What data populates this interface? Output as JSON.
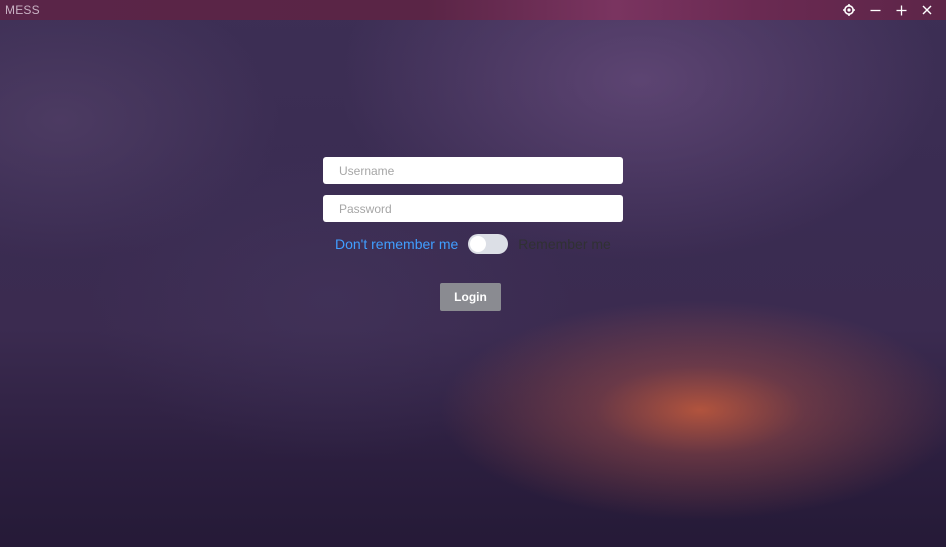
{
  "window": {
    "title": "MESS",
    "controls": [
      "settings-icon",
      "minimize-icon",
      "maximize-icon",
      "close-icon"
    ]
  },
  "login": {
    "username_placeholder": "Username",
    "username_value": "",
    "password_placeholder": "Password",
    "password_value": "",
    "remember_off_label": "Don't remember me",
    "remember_on_label": "Remember me",
    "remember_enabled": false,
    "submit_label": "Login"
  },
  "colors": {
    "titlebar": "#5a2548",
    "accent_blue": "#409eff",
    "switch_off": "#dcdfe6",
    "button_bg": "#8a8b91"
  }
}
